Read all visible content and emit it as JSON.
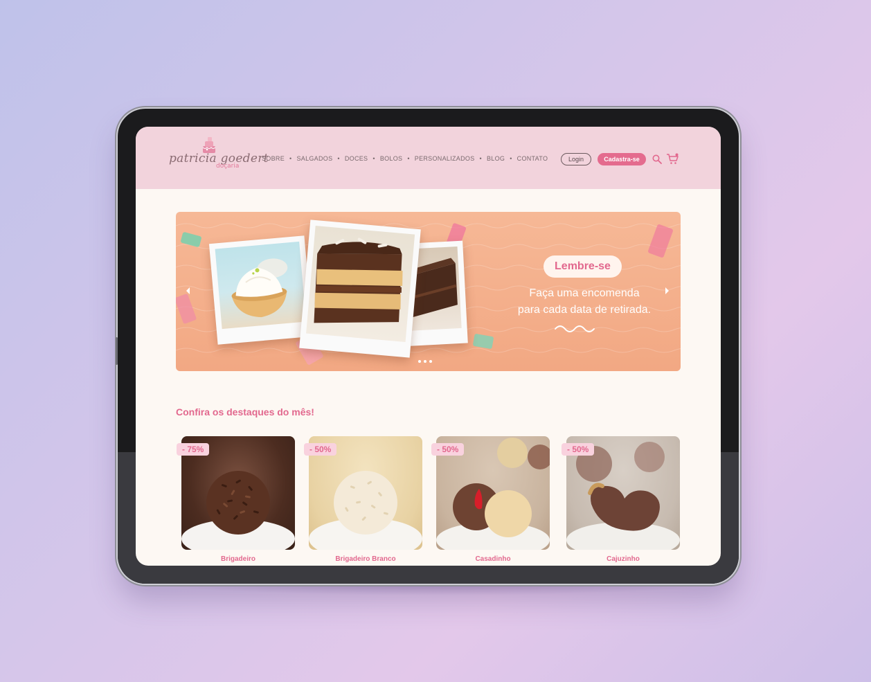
{
  "brand": {
    "logo_script": "patricia goedert",
    "logo_sub": "doçaria"
  },
  "nav": {
    "items": [
      "SOBRE",
      "SALGADOS",
      "DOCES",
      "BOLOS",
      "PERSONALIZADOS",
      "BLOG",
      "CONTATO"
    ],
    "separator": "•"
  },
  "header_actions": {
    "login": "Login",
    "signup": "Cadastra-se",
    "search_icon": "search-icon",
    "cart_icon": "cart-icon"
  },
  "banner": {
    "pill": "Lembre-se",
    "line1": "Faça uma encomenda",
    "line2": "para cada data de retirada.",
    "slide_count": 3,
    "colors": {
      "background": "#f2a883",
      "accent": "#e2688e"
    }
  },
  "highlights": {
    "title": "Confira os destaques do mês!",
    "products": [
      {
        "name": "Brigadeiro",
        "discount": "- 75%"
      },
      {
        "name": "Brigadeiro Branco",
        "discount": "- 50%"
      },
      {
        "name": "Casadinho",
        "discount": "- 50%"
      },
      {
        "name": "Cajuzinho",
        "discount": "- 50%"
      }
    ]
  }
}
